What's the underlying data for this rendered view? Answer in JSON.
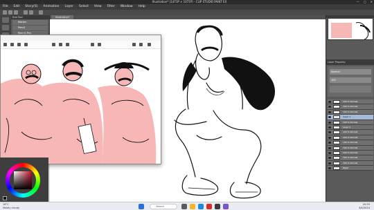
{
  "window": {
    "title": "Illustration* (1471P × 1071P) - CLIP STUDIO PAINT EX",
    "controls": [
      "—",
      "▢",
      "✕"
    ]
  },
  "menu": [
    "File",
    "Edit",
    "Story(S)",
    "Animation",
    "Layer",
    "Select",
    "View",
    "Filter",
    "Window",
    "Help"
  ],
  "subtool": {
    "header": "Sub Tool",
    "items": [
      "Marker",
      "Pencil",
      "Real G-Pen"
    ]
  },
  "canvas": {
    "tab_label": "Illustration*"
  },
  "layer_panel": {
    "header": "Layer Property",
    "blend": "Normal",
    "opacity": "100",
    "layers": [
      "100 % Normal",
      "100 % Normal",
      "100 % Normal",
      "Layer 1",
      "100 % Normal",
      "Layer 2",
      "100 % Normal",
      "100 % Normal",
      "100 % Normal",
      "100 % Normal",
      "100 % Normal",
      "100 % Normal",
      "100 % Normal",
      "Paper"
    ],
    "selected_index": 3
  },
  "taskbar": {
    "weather_line1": "16°C",
    "weather_line2": "Mostly cloudy",
    "search_label": "Search",
    "clock_time": "20:55",
    "clock_date": "3/4/2024"
  },
  "colors": {
    "accent_pink": "#f7b7b7",
    "main_color": "#c0122e"
  }
}
